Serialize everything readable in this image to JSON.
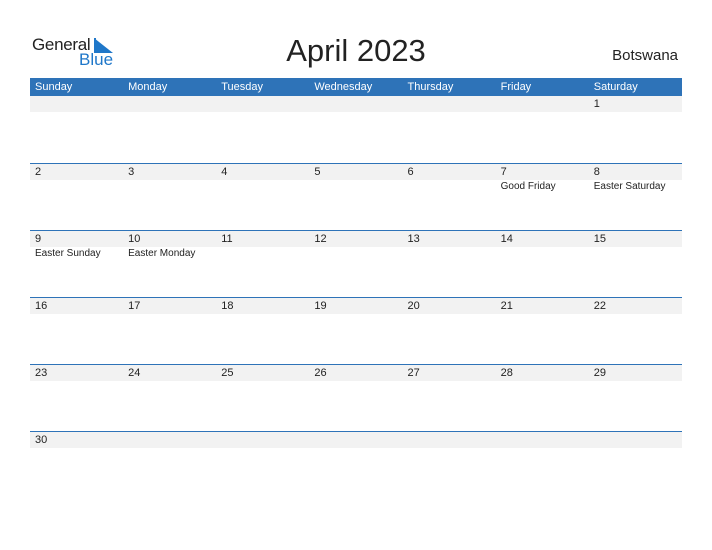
{
  "logo": {
    "word1": "General",
    "word2": "Blue"
  },
  "title": "April 2023",
  "country": "Botswana",
  "colors": {
    "header_bg": "#2e73b8",
    "date_strip_bg": "#f2f2f2",
    "brand_blue": "#1f77c9"
  },
  "weekdays": [
    "Sunday",
    "Monday",
    "Tuesday",
    "Wednesday",
    "Thursday",
    "Friday",
    "Saturday"
  ],
  "weeks": [
    {
      "days": [
        "",
        "",
        "",
        "",
        "",
        "",
        "1"
      ],
      "events": [
        "",
        "",
        "",
        "",
        "",
        "",
        ""
      ]
    },
    {
      "days": [
        "2",
        "3",
        "4",
        "5",
        "6",
        "7",
        "8"
      ],
      "events": [
        "",
        "",
        "",
        "",
        "",
        "Good Friday",
        "Easter Saturday"
      ]
    },
    {
      "days": [
        "9",
        "10",
        "11",
        "12",
        "13",
        "14",
        "15"
      ],
      "events": [
        "Easter Sunday",
        "Easter Monday",
        "",
        "",
        "",
        "",
        ""
      ]
    },
    {
      "days": [
        "16",
        "17",
        "18",
        "19",
        "20",
        "21",
        "22"
      ],
      "events": [
        "",
        "",
        "",
        "",
        "",
        "",
        ""
      ]
    },
    {
      "days": [
        "23",
        "24",
        "25",
        "26",
        "27",
        "28",
        "29"
      ],
      "events": [
        "",
        "",
        "",
        "",
        "",
        "",
        ""
      ]
    },
    {
      "days": [
        "30",
        "",
        "",
        "",
        "",
        "",
        ""
      ],
      "events": [
        "",
        "",
        "",
        "",
        "",
        "",
        ""
      ]
    }
  ]
}
